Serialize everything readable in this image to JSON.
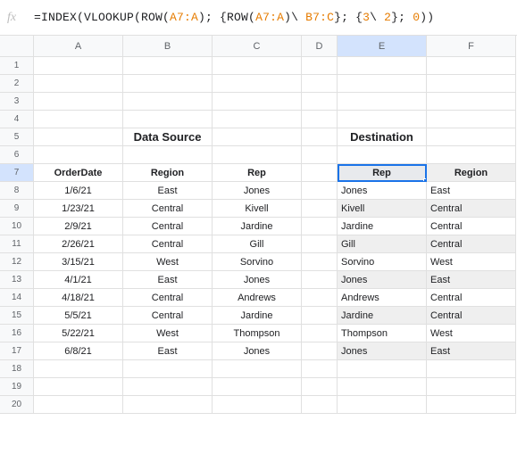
{
  "formula_bar": {
    "fx": "fx",
    "parts": [
      {
        "t": "=INDEX(VLOOKUP(ROW(",
        "c": ""
      },
      {
        "t": "A7:A",
        "c": "tok-ref"
      },
      {
        "t": "); {ROW(",
        "c": ""
      },
      {
        "t": "A7:A",
        "c": "tok-ref"
      },
      {
        "t": ")\\ ",
        "c": ""
      },
      {
        "t": "B7:C",
        "c": "tok-ref"
      },
      {
        "t": "}; {",
        "c": ""
      },
      {
        "t": "3",
        "c": "tok-ref"
      },
      {
        "t": "\\ ",
        "c": ""
      },
      {
        "t": "2",
        "c": "tok-ref"
      },
      {
        "t": "}; ",
        "c": ""
      },
      {
        "t": "0",
        "c": "tok-ref"
      },
      {
        "t": "))",
        "c": ""
      }
    ]
  },
  "columns": [
    "A",
    "B",
    "C",
    "D",
    "E",
    "F"
  ],
  "row_numbers": [
    "1",
    "2",
    "3",
    "4",
    "5",
    "6",
    "7",
    "8",
    "9",
    "10",
    "11",
    "12",
    "13",
    "14",
    "15",
    "16",
    "17",
    "18",
    "19",
    "20"
  ],
  "source_title": "Data Source",
  "dest_title": "Destination",
  "source_headers": {
    "order_date": "OrderDate",
    "region": "Region",
    "rep": "Rep"
  },
  "dest_headers": {
    "rep": "Rep",
    "region": "Region"
  },
  "selected": {
    "col": "E",
    "row": "7"
  },
  "rows": [
    {
      "date": "1/6/21",
      "sregion": "East",
      "srep": "Jones",
      "drep": "Jones",
      "dregion": "East"
    },
    {
      "date": "1/23/21",
      "sregion": "Central",
      "srep": "Kivell",
      "drep": "Kivell",
      "dregion": "Central"
    },
    {
      "date": "2/9/21",
      "sregion": "Central",
      "srep": "Jardine",
      "drep": "Jardine",
      "dregion": "Central"
    },
    {
      "date": "2/26/21",
      "sregion": "Central",
      "srep": "Gill",
      "drep": "Gill",
      "dregion": "Central"
    },
    {
      "date": "3/15/21",
      "sregion": "West",
      "srep": "Sorvino",
      "drep": "Sorvino",
      "dregion": "West"
    },
    {
      "date": "4/1/21",
      "sregion": "East",
      "srep": "Jones",
      "drep": "Jones",
      "dregion": "East"
    },
    {
      "date": "4/18/21",
      "sregion": "Central",
      "srep": "Andrews",
      "drep": "Andrews",
      "dregion": "Central"
    },
    {
      "date": "5/5/21",
      "sregion": "Central",
      "srep": "Jardine",
      "drep": "Jardine",
      "dregion": "Central"
    },
    {
      "date": "5/22/21",
      "sregion": "West",
      "srep": "Thompson",
      "drep": "Thompson",
      "dregion": "West"
    },
    {
      "date": "6/8/21",
      "sregion": "East",
      "srep": "Jones",
      "drep": "Jones",
      "dregion": "East"
    }
  ]
}
